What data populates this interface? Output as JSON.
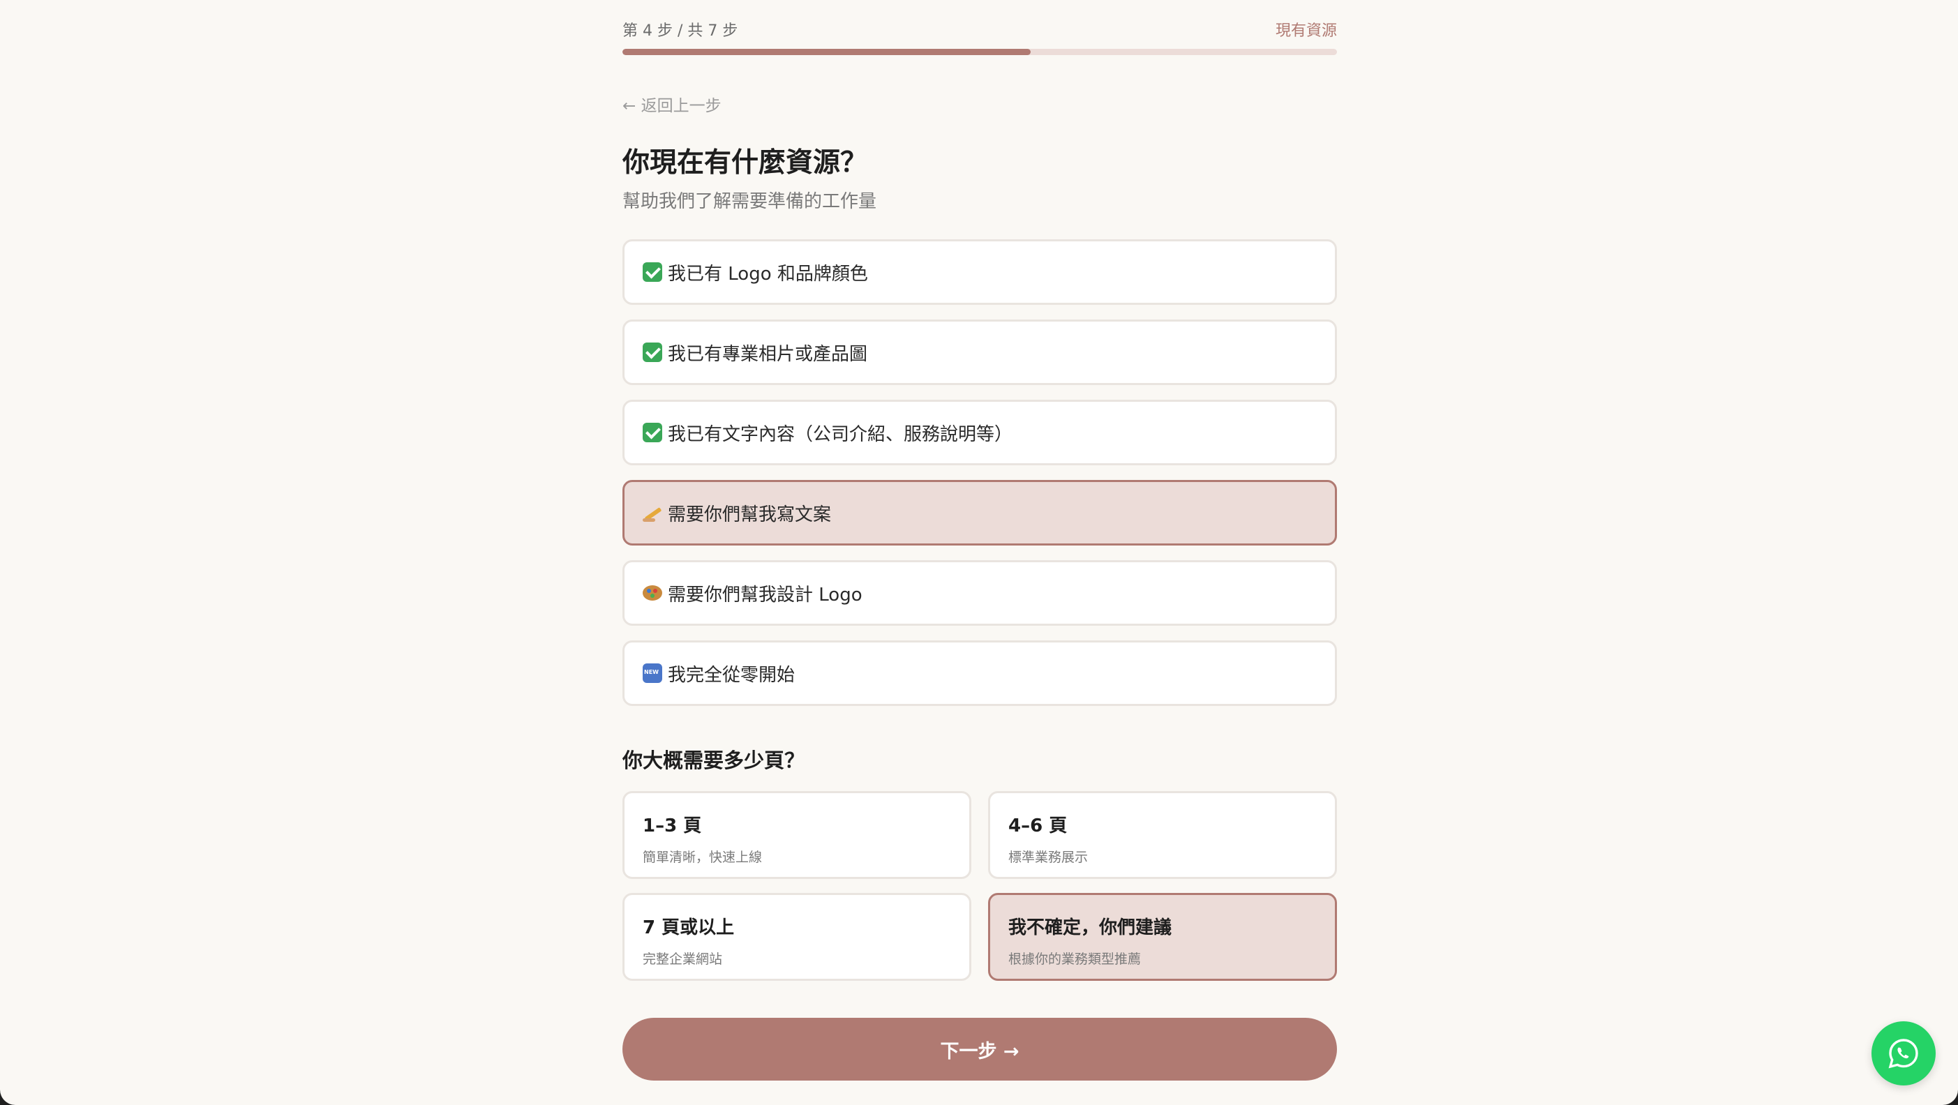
{
  "progress": {
    "step_text": "第 4 步 / 共 7 步",
    "step_name": "現有資源",
    "fraction": 0.5714
  },
  "nav": {
    "back_label": "← 返回上一步"
  },
  "question": {
    "title": "你現在有什麼資源？",
    "subtitle": "幫助我們了解需要準備的工作量"
  },
  "resources": [
    {
      "icon": "check-mark-icon",
      "label": "我已有 Logo 和品牌顏色",
      "selected": false
    },
    {
      "icon": "check-mark-icon",
      "label": "我已有專業相片或產品圖",
      "selected": false
    },
    {
      "icon": "check-mark-icon",
      "label": "我已有文字內容（公司介紹、服務說明等）",
      "selected": false
    },
    {
      "icon": "writing-hand-icon",
      "label": "需要你們幫我寫文案",
      "selected": true
    },
    {
      "icon": "palette-icon",
      "label": "需要你們幫我設計 Logo",
      "selected": false
    },
    {
      "icon": "new-badge-icon",
      "label": "我完全從零開始",
      "selected": false
    }
  ],
  "pages_question": "你大概需要多少頁？",
  "page_options": [
    {
      "title": "1–3 頁",
      "desc": "簡單清晰，快速上線",
      "selected": false
    },
    {
      "title": "4–6 頁",
      "desc": "標準業務展示",
      "selected": false
    },
    {
      "title": "7 頁或以上",
      "desc": "完整企業網站",
      "selected": false
    },
    {
      "title": "我不確定，你們建議",
      "desc": "根據你的業務類型推薦",
      "selected": true
    }
  ],
  "next_label": "下一步 →",
  "colors": {
    "accent": "#b07a72",
    "selected_bg": "#ecdcd8",
    "page_bg": "#faf8f4",
    "whatsapp": "#25d366"
  }
}
